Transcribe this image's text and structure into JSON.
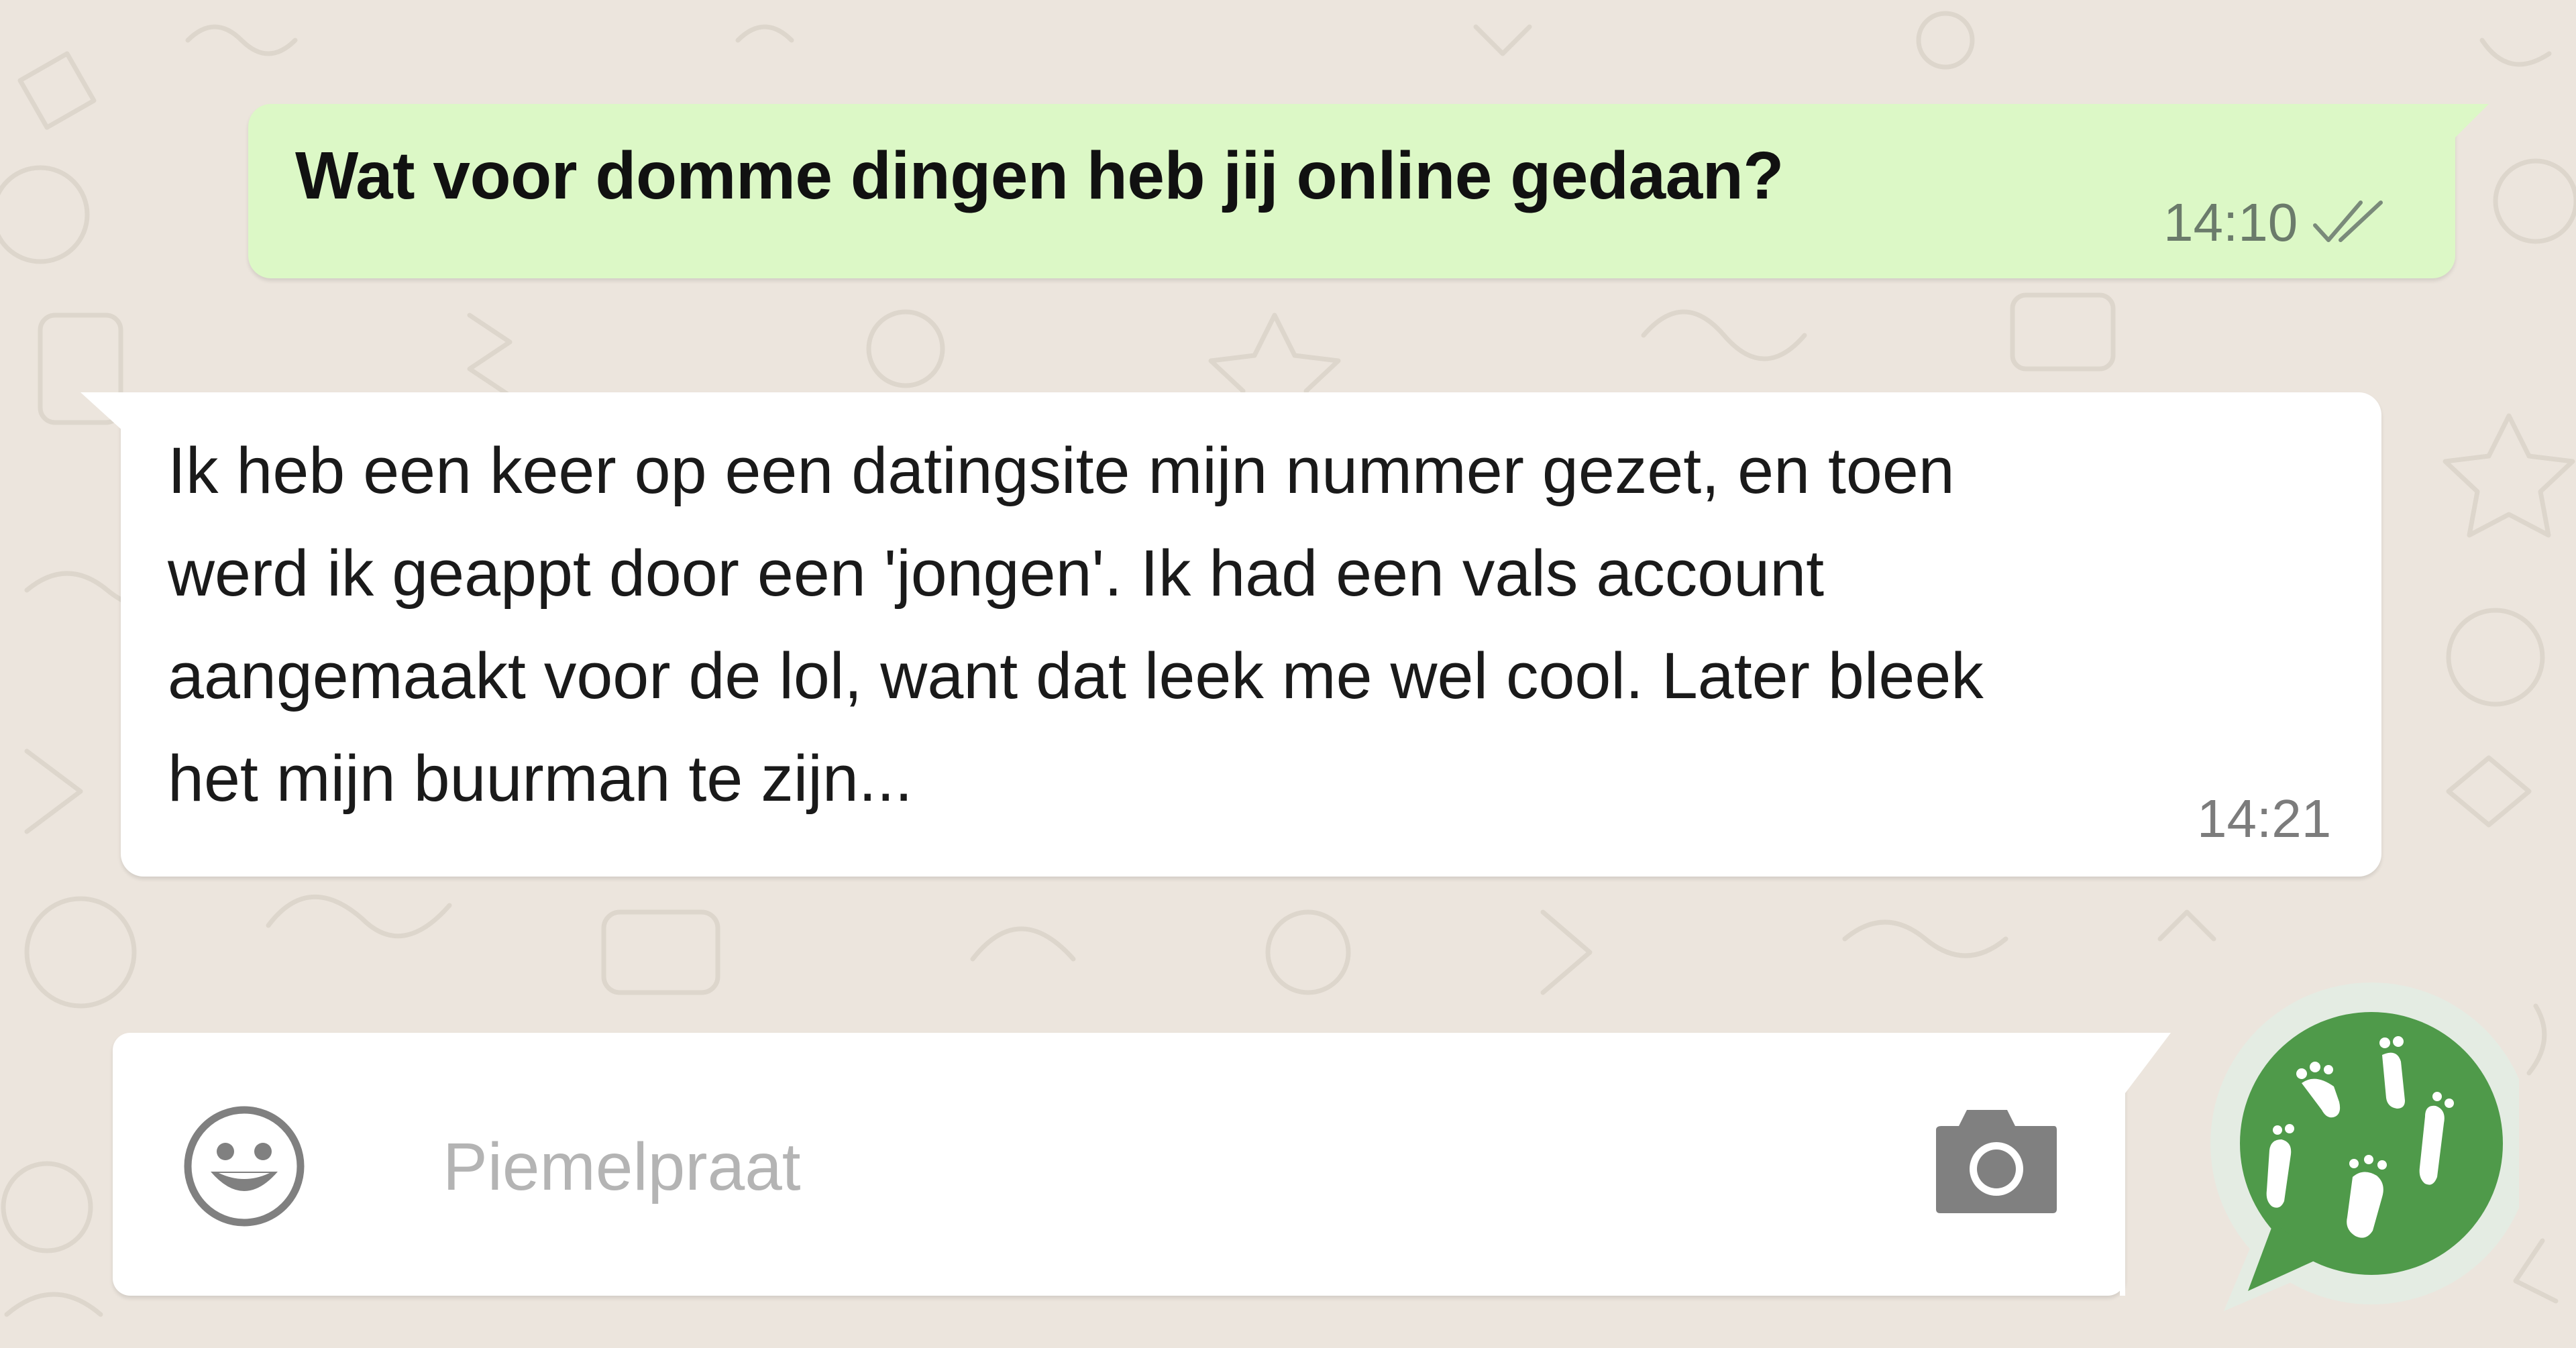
{
  "conversation": {
    "outgoing": {
      "text": "Wat voor domme dingen heb jij online gedaan?",
      "time": "14:10",
      "status_icon": "double-check-icon"
    },
    "incoming": {
      "lines": [
        "Ik heb een keer op een datingsite mijn nummer gezet, en toen",
        "werd ik geappt door een 'jongen'. Ik had een vals account",
        "aangemaakt voor de lol, want dat leek me wel cool. Later bleek",
        "het mijn buurman te zijn..."
      ],
      "time": "14:21"
    }
  },
  "composer": {
    "placeholder": "Piemelpraat",
    "value": "",
    "left_icon": "smiley-icon",
    "right_icon": "camera-icon"
  },
  "logo": {
    "icon": "chat-bubble-footprints-logo"
  },
  "colors": {
    "background": "#ece5dd",
    "outgoing_bubble": "#dcf8c6",
    "incoming_bubble": "#ffffff",
    "logo_green": "#4f9a4a",
    "icon_gray": "#808080"
  }
}
